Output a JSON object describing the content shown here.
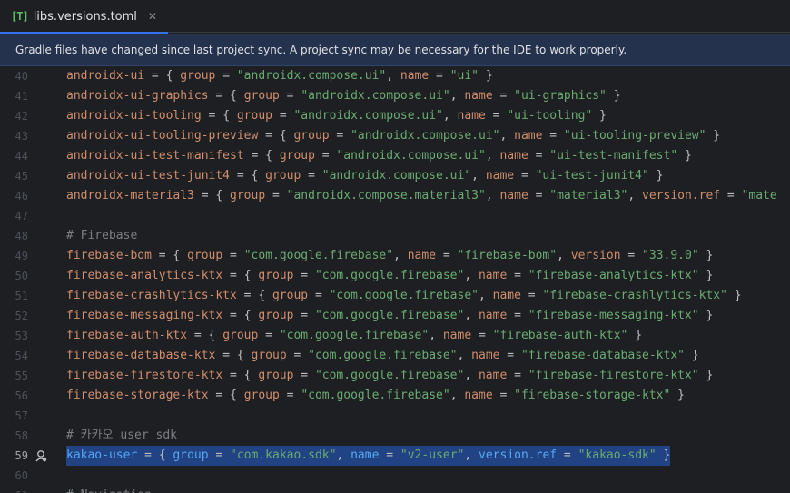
{
  "tab": {
    "icon_text": "[T]",
    "title": "libs.versions.toml",
    "close_glyph": "✕"
  },
  "banner": {
    "message": "Gradle files have changed since last project sync. A project sync may be necessary for the IDE to work properly."
  },
  "editor": {
    "lines": [
      {
        "num": "40",
        "segs": [
          [
            "k",
            "androidx-ui"
          ],
          [
            "p",
            " = { "
          ],
          [
            "k",
            "group"
          ],
          [
            "p",
            " = "
          ],
          [
            "s",
            "\"androidx.compose.ui\""
          ],
          [
            "p",
            ", "
          ],
          [
            "k",
            "name"
          ],
          [
            "p",
            " = "
          ],
          [
            "s",
            "\"ui\""
          ],
          [
            "p",
            " }"
          ]
        ]
      },
      {
        "num": "41",
        "segs": [
          [
            "k",
            "androidx-ui-graphics"
          ],
          [
            "p",
            " = { "
          ],
          [
            "k",
            "group"
          ],
          [
            "p",
            " = "
          ],
          [
            "s",
            "\"androidx.compose.ui\""
          ],
          [
            "p",
            ", "
          ],
          [
            "k",
            "name"
          ],
          [
            "p",
            " = "
          ],
          [
            "s",
            "\"ui-graphics\""
          ],
          [
            "p",
            " }"
          ]
        ]
      },
      {
        "num": "42",
        "segs": [
          [
            "k",
            "androidx-ui-tooling"
          ],
          [
            "p",
            " = { "
          ],
          [
            "k",
            "group"
          ],
          [
            "p",
            " = "
          ],
          [
            "s",
            "\"androidx.compose.ui\""
          ],
          [
            "p",
            ", "
          ],
          [
            "k",
            "name"
          ],
          [
            "p",
            " = "
          ],
          [
            "s",
            "\"ui-tooling\""
          ],
          [
            "p",
            " }"
          ]
        ]
      },
      {
        "num": "43",
        "segs": [
          [
            "k",
            "androidx-ui-tooling-preview"
          ],
          [
            "p",
            " = { "
          ],
          [
            "k",
            "group"
          ],
          [
            "p",
            " = "
          ],
          [
            "s",
            "\"androidx.compose.ui\""
          ],
          [
            "p",
            ", "
          ],
          [
            "k",
            "name"
          ],
          [
            "p",
            " = "
          ],
          [
            "s",
            "\"ui-tooling-preview\""
          ],
          [
            "p",
            " }"
          ]
        ]
      },
      {
        "num": "44",
        "segs": [
          [
            "k",
            "androidx-ui-test-manifest"
          ],
          [
            "p",
            " = { "
          ],
          [
            "k",
            "group"
          ],
          [
            "p",
            " = "
          ],
          [
            "s",
            "\"androidx.compose.ui\""
          ],
          [
            "p",
            ", "
          ],
          [
            "k",
            "name"
          ],
          [
            "p",
            " = "
          ],
          [
            "s",
            "\"ui-test-manifest\""
          ],
          [
            "p",
            " }"
          ]
        ]
      },
      {
        "num": "45",
        "segs": [
          [
            "k",
            "androidx-ui-test-junit4"
          ],
          [
            "p",
            " = { "
          ],
          [
            "k",
            "group"
          ],
          [
            "p",
            " = "
          ],
          [
            "s",
            "\"androidx.compose.ui\""
          ],
          [
            "p",
            ", "
          ],
          [
            "k",
            "name"
          ],
          [
            "p",
            " = "
          ],
          [
            "s",
            "\"ui-test-junit4\""
          ],
          [
            "p",
            " }"
          ]
        ]
      },
      {
        "num": "46",
        "segs": [
          [
            "k",
            "androidx-material3"
          ],
          [
            "p",
            " = { "
          ],
          [
            "k",
            "group"
          ],
          [
            "p",
            " = "
          ],
          [
            "s",
            "\"androidx.compose.material3\""
          ],
          [
            "p",
            ", "
          ],
          [
            "k",
            "name"
          ],
          [
            "p",
            " = "
          ],
          [
            "s",
            "\"material3\""
          ],
          [
            "p",
            ", "
          ],
          [
            "k",
            "version.ref"
          ],
          [
            "p",
            " = "
          ],
          [
            "s",
            "\"mate"
          ]
        ]
      },
      {
        "num": "47",
        "segs": []
      },
      {
        "num": "48",
        "segs": [
          [
            "c",
            "# Firebase"
          ]
        ]
      },
      {
        "num": "49",
        "segs": [
          [
            "k",
            "firebase-bom"
          ],
          [
            "p",
            " = { "
          ],
          [
            "k",
            "group"
          ],
          [
            "p",
            " = "
          ],
          [
            "s",
            "\"com.google.firebase\""
          ],
          [
            "p",
            ", "
          ],
          [
            "k",
            "name"
          ],
          [
            "p",
            " = "
          ],
          [
            "s",
            "\"firebase-bom\""
          ],
          [
            "p",
            ", "
          ],
          [
            "k",
            "version"
          ],
          [
            "p",
            " = "
          ],
          [
            "s",
            "\"33.9.0\""
          ],
          [
            "p",
            " }"
          ]
        ]
      },
      {
        "num": "50",
        "segs": [
          [
            "k",
            "firebase-analytics-ktx"
          ],
          [
            "p",
            " = { "
          ],
          [
            "k",
            "group"
          ],
          [
            "p",
            " = "
          ],
          [
            "s",
            "\"com.google.firebase\""
          ],
          [
            "p",
            ", "
          ],
          [
            "k",
            "name"
          ],
          [
            "p",
            " = "
          ],
          [
            "s",
            "\"firebase-analytics-ktx\""
          ],
          [
            "p",
            " }"
          ]
        ]
      },
      {
        "num": "51",
        "segs": [
          [
            "k",
            "firebase-crashlytics-ktx"
          ],
          [
            "p",
            " = { "
          ],
          [
            "k",
            "group"
          ],
          [
            "p",
            " = "
          ],
          [
            "s",
            "\"com.google.firebase\""
          ],
          [
            "p",
            ", "
          ],
          [
            "k",
            "name"
          ],
          [
            "p",
            " = "
          ],
          [
            "s",
            "\"firebase-crashlytics-ktx\""
          ],
          [
            "p",
            " }"
          ]
        ]
      },
      {
        "num": "52",
        "segs": [
          [
            "k",
            "firebase-messaging-ktx"
          ],
          [
            "p",
            " = { "
          ],
          [
            "k",
            "group"
          ],
          [
            "p",
            " = "
          ],
          [
            "s",
            "\"com.google.firebase\""
          ],
          [
            "p",
            ", "
          ],
          [
            "k",
            "name"
          ],
          [
            "p",
            " = "
          ],
          [
            "s",
            "\"firebase-messaging-ktx\""
          ],
          [
            "p",
            " }"
          ]
        ]
      },
      {
        "num": "53",
        "segs": [
          [
            "k",
            "firebase-auth-ktx"
          ],
          [
            "p",
            " = { "
          ],
          [
            "k",
            "group"
          ],
          [
            "p",
            " = "
          ],
          [
            "s",
            "\"com.google.firebase\""
          ],
          [
            "p",
            ", "
          ],
          [
            "k",
            "name"
          ],
          [
            "p",
            " = "
          ],
          [
            "s",
            "\"firebase-auth-ktx\""
          ],
          [
            "p",
            " }"
          ]
        ]
      },
      {
        "num": "54",
        "segs": [
          [
            "k",
            "firebase-database-ktx"
          ],
          [
            "p",
            " = { "
          ],
          [
            "k",
            "group"
          ],
          [
            "p",
            " = "
          ],
          [
            "s",
            "\"com.google.firebase\""
          ],
          [
            "p",
            ", "
          ],
          [
            "k",
            "name"
          ],
          [
            "p",
            " = "
          ],
          [
            "s",
            "\"firebase-database-ktx\""
          ],
          [
            "p",
            " }"
          ]
        ]
      },
      {
        "num": "55",
        "segs": [
          [
            "k",
            "firebase-firestore-ktx"
          ],
          [
            "p",
            " = { "
          ],
          [
            "k",
            "group"
          ],
          [
            "p",
            " = "
          ],
          [
            "s",
            "\"com.google.firebase\""
          ],
          [
            "p",
            ", "
          ],
          [
            "k",
            "name"
          ],
          [
            "p",
            " = "
          ],
          [
            "s",
            "\"firebase-firestore-ktx\""
          ],
          [
            "p",
            " }"
          ]
        ]
      },
      {
        "num": "56",
        "segs": [
          [
            "k",
            "firebase-storage-ktx"
          ],
          [
            "p",
            " = { "
          ],
          [
            "k",
            "group"
          ],
          [
            "p",
            " = "
          ],
          [
            "s",
            "\"com.google.firebase\""
          ],
          [
            "p",
            ", "
          ],
          [
            "k",
            "name"
          ],
          [
            "p",
            " = "
          ],
          [
            "s",
            "\"firebase-storage-ktx\""
          ],
          [
            "p",
            " }"
          ]
        ]
      },
      {
        "num": "57",
        "segs": []
      },
      {
        "num": "58",
        "segs": [
          [
            "c",
            "# 카카오 user sdk"
          ]
        ]
      },
      {
        "num": "59",
        "selected": true,
        "segs": [
          [
            "k",
            "kakao-user"
          ],
          [
            "p",
            " = { "
          ],
          [
            "k",
            "group"
          ],
          [
            "p",
            " = "
          ],
          [
            "s",
            "\"com.kakao.sdk\""
          ],
          [
            "p",
            ", "
          ],
          [
            "k",
            "name"
          ],
          [
            "p",
            " = "
          ],
          [
            "s",
            "\"v2-user\""
          ],
          [
            "p",
            ", "
          ],
          [
            "k",
            "version.ref"
          ],
          [
            "p",
            " = "
          ],
          [
            "s",
            "\"kakao-sdk\""
          ],
          [
            "p",
            " }"
          ]
        ]
      },
      {
        "num": "60",
        "segs": []
      },
      {
        "num": "61",
        "segs": [
          [
            "c",
            "# Navigation"
          ]
        ]
      }
    ]
  }
}
